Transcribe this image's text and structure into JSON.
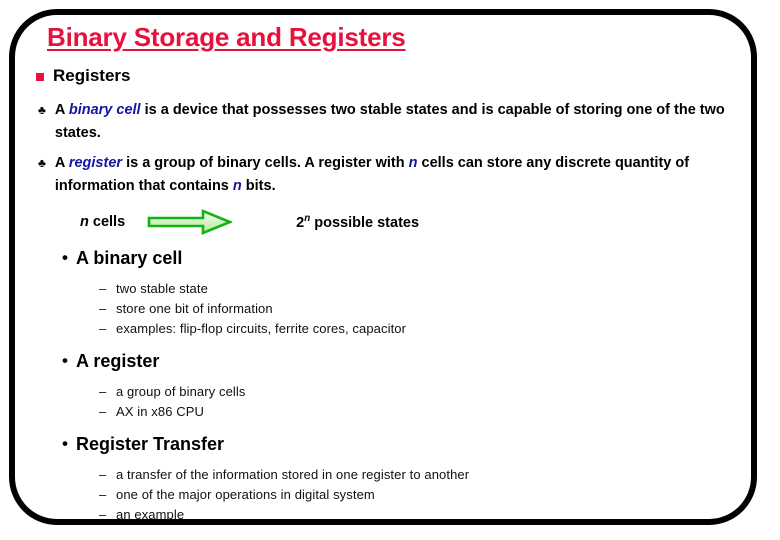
{
  "slide": {
    "title": "Binary Storage and Registers",
    "title_color": "#E8103C",
    "frame_color": "#000000",
    "background": "#ffffff"
  },
  "section": {
    "bullet_icon": "red-square-bullet",
    "heading": "Registers"
  },
  "definitions": [
    {
      "bullet_icon": "club-suit-bullet",
      "lead": "A ",
      "emphasis": "binary cell",
      "rest": " is a device that possesses two stable states and is capable of storing one of the two states."
    },
    {
      "bullet_icon": "club-suit-bullet",
      "lead": "A ",
      "emphasis": "register",
      "rest_a": " is a group of binary cells. A register with ",
      "var_n": "n",
      "rest_b": " cells can store any discrete quantity of information that contains ",
      "var_n2": "n",
      "rest_c": " bits."
    }
  ],
  "diagram": {
    "left_label_var": "n",
    "left_label_text": " cells",
    "arrow_icon": "green-block-arrow-right",
    "arrow_outline_color": "#00B400",
    "arrow_fill_color": "#D9F5CC",
    "right_label_base": "2",
    "right_label_sup": "n",
    "right_label_text": " possible states"
  },
  "outline": [
    {
      "bullet_icon": "dot-bullet",
      "heading": "A binary cell",
      "sub_bullet_icon": "dash-bullet",
      "items": [
        "two stable state",
        "store one bit of information",
        "examples: flip-flop circuits, ferrite cores, capacitor"
      ]
    },
    {
      "bullet_icon": "dot-bullet",
      "heading": "A register",
      "sub_bullet_icon": "dash-bullet",
      "items": [
        "a group of binary cells",
        "AX in x86 CPU"
      ]
    },
    {
      "bullet_icon": "dot-bullet",
      "heading": "Register Transfer",
      "sub_bullet_icon": "dash-bullet",
      "items": [
        "a transfer of the information stored in one register to another",
        "one of the major operations in digital system",
        "an example"
      ]
    }
  ],
  "glyphs": {
    "club": "♣",
    "dot": "•",
    "dash": "–"
  }
}
